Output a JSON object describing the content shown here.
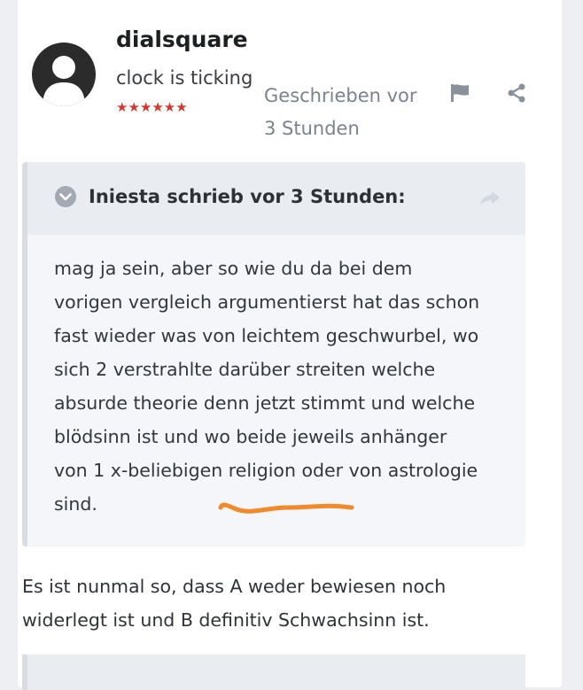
{
  "post": {
    "author": {
      "name": "dialsquare",
      "title": "clock is ticking",
      "rank_stars": "★★★★★★",
      "avatar_icon": "user-silhouette-icon"
    },
    "posted_line1": "Geschrieben vor",
    "posted_line2": "3 Stunden",
    "actions": {
      "flag_icon": "flag-icon",
      "share_icon": "share-icon"
    },
    "quote": {
      "citation": "Iniesta schrieb vor 3 Stunden:",
      "toggle_icon": "chevron-down-circle-icon",
      "share_icon": "share-arrow-icon",
      "lines": [
        "mag ja sein, aber so wie du da bei dem",
        "vorigen vergleich argumentierst hat das schon",
        "fast wieder was von leichtem geschwurbel, wo",
        "sich 2 verstrahlte darüber streiten welche",
        "absurde theorie denn jetzt stimmt und welche",
        "blödsinn ist und wo beide jeweils anhänger",
        "von 1 x-beliebigen religion oder von astrologie",
        "sind."
      ]
    },
    "body_lines": [
      "Es ist nunmal so, dass A weder bewiesen noch",
      "widerlegt ist und B definitiv Schwachsinn ist."
    ]
  },
  "colors": {
    "rank": "#d0392b",
    "annotation": "#f08a2a",
    "muted": "#7b828d"
  }
}
